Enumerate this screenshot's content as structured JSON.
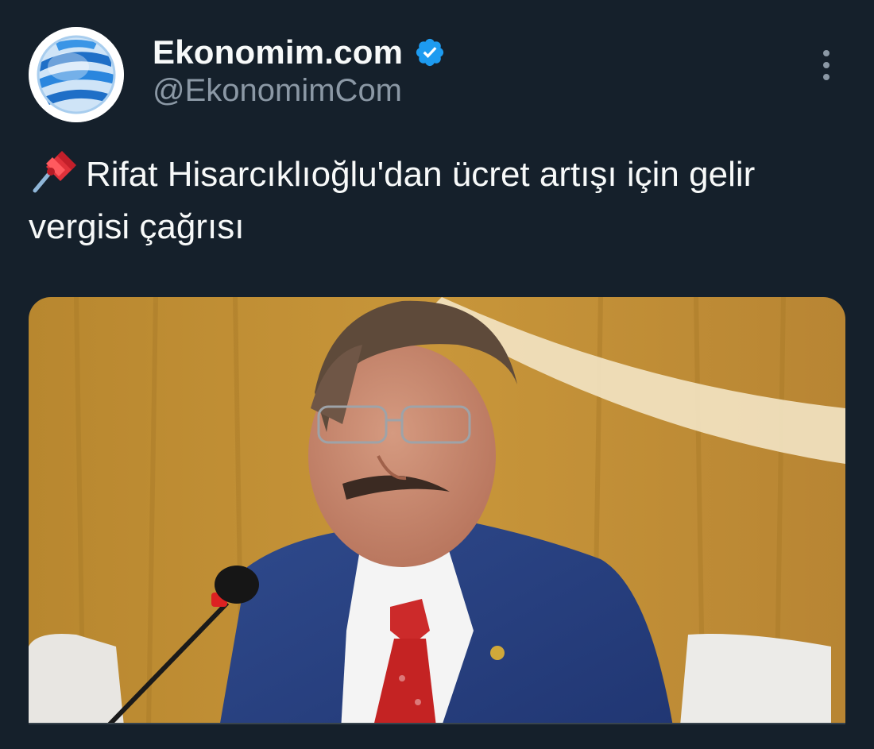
{
  "tweet": {
    "author": {
      "display_name": "Ekonomim.com",
      "handle": "@EkonomimCom",
      "verified": true,
      "avatar_icon": "globe-logo-icon",
      "verified_icon": "verified-badge-icon"
    },
    "more_icon": "more-options-icon",
    "text_emoji_icon": "pushpin-icon",
    "text": "Rifat Hisarcıklıoğlu'dan ücret artışı için gelir vergisi çağrısı",
    "media": {
      "type": "photo",
      "subject": "man-in-suit-at-microphone"
    }
  },
  "colors": {
    "background": "#15202b",
    "primary_text": "#f7f9f9",
    "secondary_text": "#8b98a5",
    "verified_blue": "#1d9bf0",
    "border": "#38444d"
  }
}
